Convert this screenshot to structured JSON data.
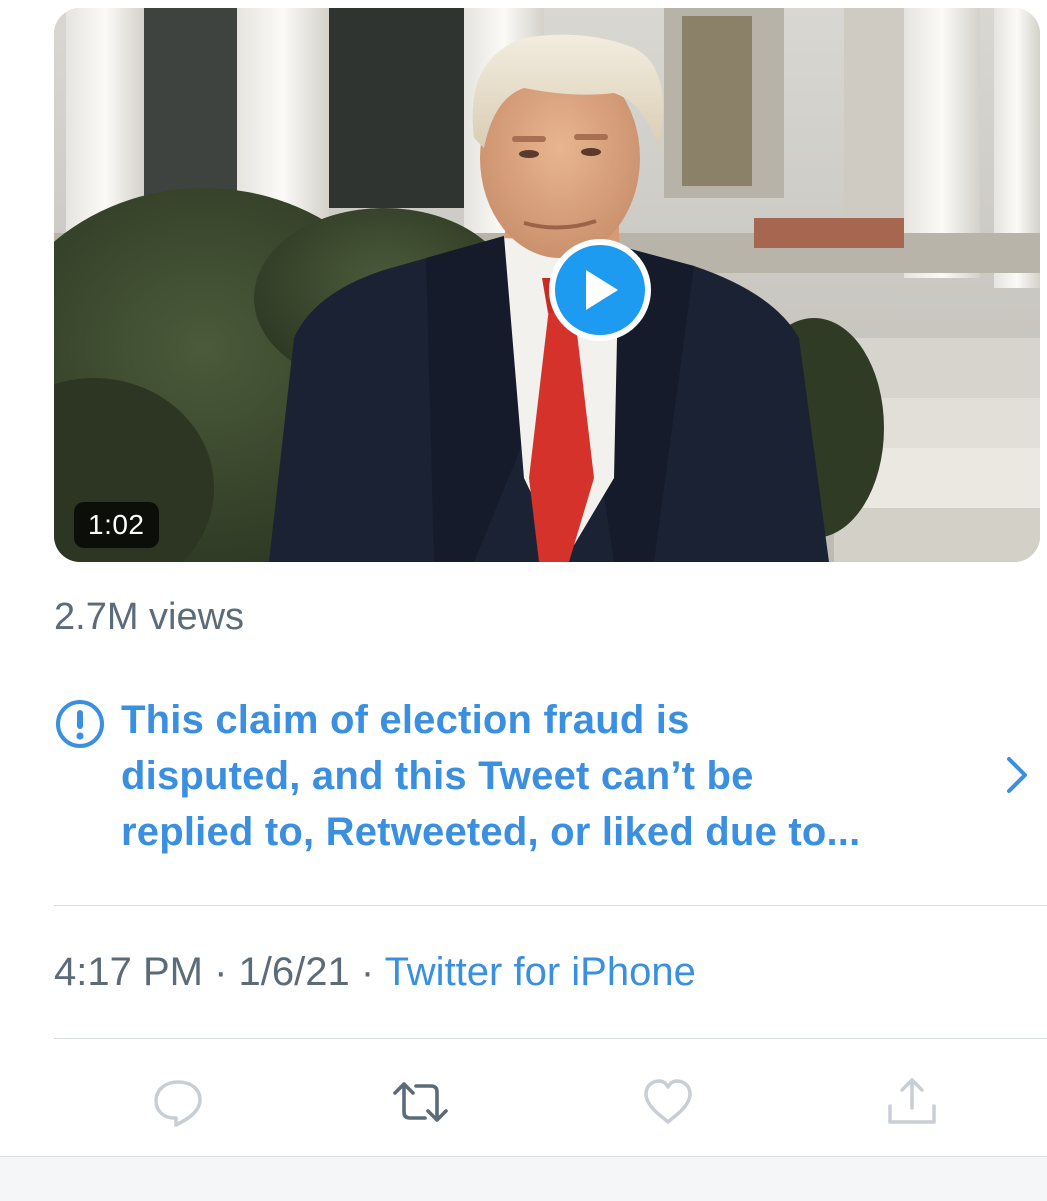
{
  "video": {
    "duration": "1:02",
    "play_icon": "play-icon"
  },
  "views": "2.7M views",
  "notice": {
    "icon": "exclamation-circle-icon",
    "lines": [
      "This claim of election fraud is",
      "disputed, and this Tweet can’t be",
      "replied to, Retweeted, or liked due to..."
    ],
    "chevron": "chevron-right-icon"
  },
  "meta": {
    "time": "4:17 PM",
    "separator": " · ",
    "date": "1/6/21",
    "source": "Twitter for iPhone"
  },
  "actions": {
    "reply_icon": "reply-icon",
    "retweet_icon": "retweet-icon",
    "like_icon": "heart-icon",
    "share_icon": "share-icon"
  },
  "colors": {
    "accent": "#3a8fe0",
    "play_button": "#1d9bf0",
    "secondary_text": "#5b6b77",
    "muted_icon": "#c8ced4",
    "active_icon": "#5b6b77"
  }
}
